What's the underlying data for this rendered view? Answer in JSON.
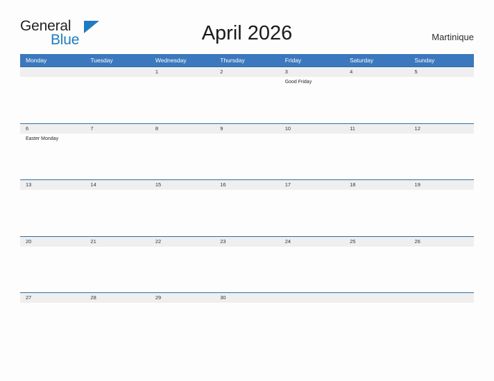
{
  "brand": {
    "name_part1": "General",
    "name_part2": "Blue",
    "flag_icon": "blue-triangle-flag",
    "color_dark": "#231f20",
    "color_blue": "#1f7bc1"
  },
  "header": {
    "title": "April 2026",
    "region": "Martinique"
  },
  "calendar": {
    "accent_color": "#3b78bd",
    "date_band_color": "#efefef",
    "weekdays": [
      "Monday",
      "Tuesday",
      "Wednesday",
      "Thursday",
      "Friday",
      "Saturday",
      "Sunday"
    ],
    "weeks": [
      {
        "days": [
          {
            "num": "",
            "events": []
          },
          {
            "num": "",
            "events": []
          },
          {
            "num": "1",
            "events": []
          },
          {
            "num": "2",
            "events": []
          },
          {
            "num": "3",
            "events": [
              "Good Friday"
            ]
          },
          {
            "num": "4",
            "events": []
          },
          {
            "num": "5",
            "events": []
          }
        ]
      },
      {
        "days": [
          {
            "num": "6",
            "events": [
              "Easter Monday"
            ]
          },
          {
            "num": "7",
            "events": []
          },
          {
            "num": "8",
            "events": []
          },
          {
            "num": "9",
            "events": []
          },
          {
            "num": "10",
            "events": []
          },
          {
            "num": "11",
            "events": []
          },
          {
            "num": "12",
            "events": []
          }
        ]
      },
      {
        "days": [
          {
            "num": "13",
            "events": []
          },
          {
            "num": "14",
            "events": []
          },
          {
            "num": "15",
            "events": []
          },
          {
            "num": "16",
            "events": []
          },
          {
            "num": "17",
            "events": []
          },
          {
            "num": "18",
            "events": []
          },
          {
            "num": "19",
            "events": []
          }
        ]
      },
      {
        "days": [
          {
            "num": "20",
            "events": []
          },
          {
            "num": "21",
            "events": []
          },
          {
            "num": "22",
            "events": []
          },
          {
            "num": "23",
            "events": []
          },
          {
            "num": "24",
            "events": []
          },
          {
            "num": "25",
            "events": []
          },
          {
            "num": "26",
            "events": []
          }
        ]
      },
      {
        "days": [
          {
            "num": "27",
            "events": []
          },
          {
            "num": "28",
            "events": []
          },
          {
            "num": "29",
            "events": []
          },
          {
            "num": "30",
            "events": []
          },
          {
            "num": "",
            "events": []
          },
          {
            "num": "",
            "events": []
          },
          {
            "num": "",
            "events": []
          }
        ]
      }
    ]
  }
}
